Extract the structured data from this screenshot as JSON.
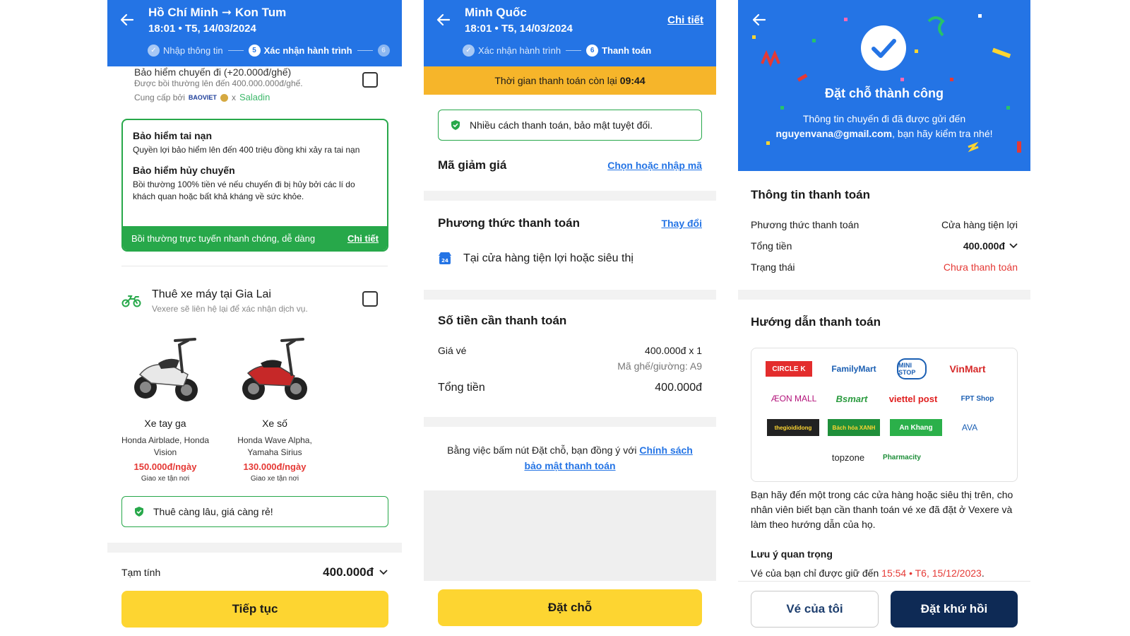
{
  "colors": {
    "primary": "#2474e5",
    "yellow": "#fdd531",
    "green": "#27a84a",
    "red": "#e53935",
    "navy": "#0e2a55",
    "timer": "#f6b52a"
  },
  "screen1": {
    "header": {
      "route": "Hồ Chí Minh ➞ Kon Tum",
      "datetime": "18:01 • T5, 14/03/2024",
      "steps": [
        {
          "num": "",
          "label": "Nhập thông tin"
        },
        {
          "num": "5",
          "label": "Xác nhận hành trình"
        },
        {
          "num": "6",
          "label": ""
        }
      ]
    },
    "top_insurance": {
      "cut_title": "Bảo hiểm chuyến đi (+20.000đ/ghế)",
      "line1": "Được bồi thường lên đến 400.000.000đ/ghế.",
      "provided_by": "Cung cấp bởi",
      "brand1": "BAOVIET",
      "x": "x",
      "brand2": "Saladin"
    },
    "insurance_box": {
      "accident_title": "Bảo hiểm tai nạn",
      "accident_desc": "Quyền lợi bảo hiểm lên đến 400 triệu đồng khi xảy ra tai nạn",
      "cancel_title": "Bảo hiểm hủy chuyến",
      "cancel_desc": "Bồi thường 100% tiền vé nếu chuyến đi bị hủy bởi các lí do khách quan hoặc bất khả kháng về sức khỏe.",
      "bar_text": "Bồi thường trực tuyến nhanh chóng, dễ dàng",
      "bar_link": "Chi tiết"
    },
    "rental": {
      "title": "Thuê xe máy tại Gia Lai",
      "subtitle": "Vexere sẽ liên hệ lại để xác nhận dịch vụ.",
      "bikes": [
        {
          "name": "Xe tay ga",
          "models": "Honda Airblade, Honda Vision",
          "price": "150.000đ/ngày",
          "delivery": "Giao xe tận nơi"
        },
        {
          "name": "Xe số",
          "models": "Honda Wave Alpha, Yamaha Sirius",
          "price": "130.000đ/ngày",
          "delivery": "Giao xe tận nơi"
        }
      ],
      "note": "Thuê càng lâu, giá càng rẻ!"
    },
    "subtotal_label": "Tạm tính",
    "subtotal_value": "400.000đ",
    "continue_button": "Tiếp tục"
  },
  "screen2": {
    "header": {
      "name": "Minh Quốc",
      "datetime": "18:01 • T5, 14/03/2024",
      "detail_link": "Chi tiết",
      "steps": [
        {
          "num": "",
          "label": "Xác nhận hành trình"
        },
        {
          "num": "6",
          "label": "Thanh toán"
        }
      ]
    },
    "timer_label": "Thời gian thanh toán còn lại",
    "timer_value": "09:44",
    "secure_note": "Nhiều cách thanh toán, bảo mật tuyệt đối.",
    "discount_label": "Mã giảm giá",
    "discount_link": "Chọn hoặc nhập mã",
    "method_title": "Phương thức thanh toán",
    "method_change": "Thay đổi",
    "method_value": "Tại cửa hàng tiện lợi hoặc siêu thị",
    "amount_title": "Số tiền cần thanh toán",
    "ticket_label": "Giá vé",
    "ticket_value": "400.000đ x 1",
    "seat_label": "Mã ghế/giường: A9",
    "total_label": "Tổng tiền",
    "total_value": "400.000đ",
    "terms_text": "Bằng việc bấm nút Đặt chỗ, bạn đồng ý với",
    "terms_link": "Chính sách bảo mật thanh toán",
    "book_button": "Đặt chỗ"
  },
  "screen3": {
    "success_title": "Đặt chỗ thành công",
    "success_msg_1": "Thông tin chuyến đi đã được gửi đến",
    "success_email": "nguyenvana@gmail.com",
    "success_msg_2": ", bạn hãy kiểm tra nhé!",
    "payment_info_title": "Thông tin thanh toán",
    "rows": [
      {
        "label": "Phương thức thanh toán",
        "value": "Cửa hàng tiện lợi"
      },
      {
        "label": "Tổng tiền",
        "value": "400.000đ"
      },
      {
        "label": "Trạng thái",
        "value": "Chưa thanh toán"
      }
    ],
    "guide_title": "Hướng dẫn thanh toán",
    "stores": [
      "CIRCLE K",
      "FamilyMart",
      "MINI STOP",
      "VinMart",
      "ÆON MALL",
      "Bsmart",
      "viettel post",
      "FPT Shop",
      "thegioididong",
      "Bách hóa XANH",
      "An Khang",
      "AVA",
      "topzone",
      "Pharmacity"
    ],
    "guide_text": "Bạn hãy đến một trong các cửa hàng hoặc siêu thị trên, cho nhân viên biết bạn cần thanh toán vé xe đã đặt ở Vexere và làm theo hướng dẫn của họ.",
    "note_title": "Lưu ý quan trọng",
    "note_prefix": "Vé của bạn chỉ được giữ đến",
    "note_deadline": "15:54 • T6, 15/12/2023",
    "my_tickets_button": "Vé của tôi",
    "return_button": "Đặt khứ hồi"
  }
}
